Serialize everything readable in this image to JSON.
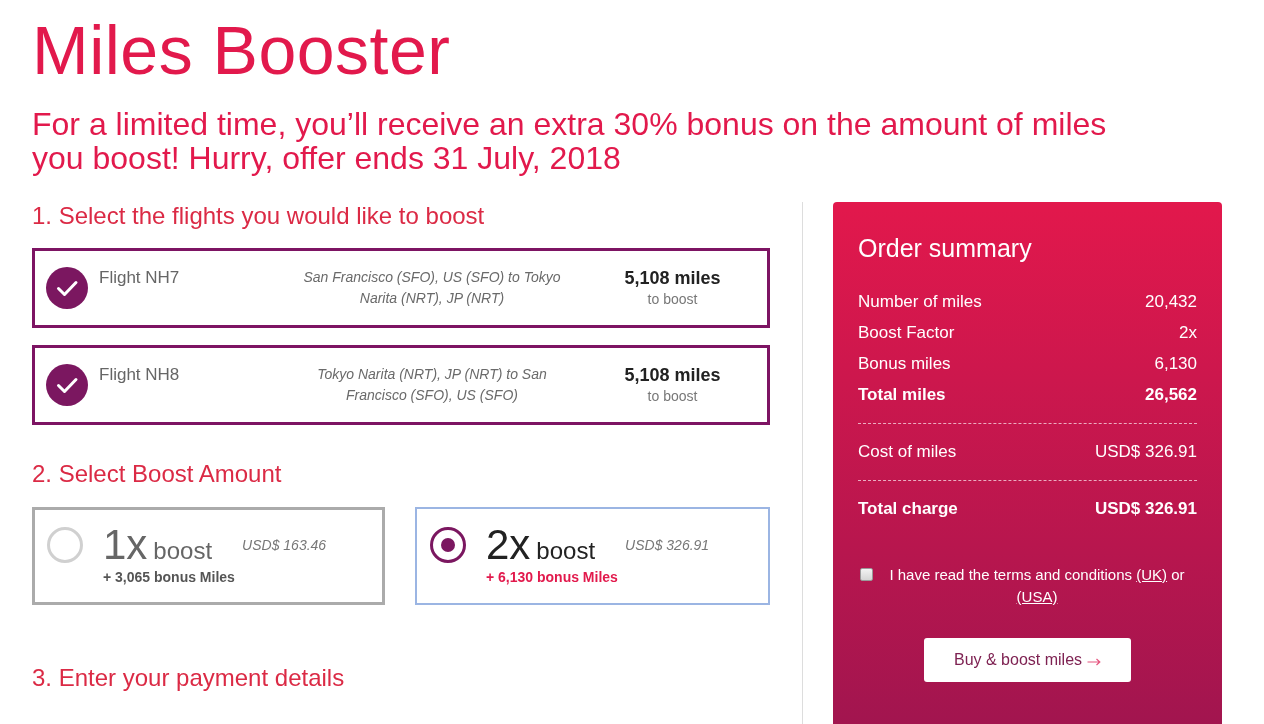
{
  "title": "Miles Booster",
  "promo": "For a limited time, you’ll receive an extra 30% bonus on the amount of miles you boost! Hurry, offer ends 31 July, 2018",
  "flights_section": {
    "heading": "1. Select the flights you would like to boost",
    "flights": [
      {
        "name": "Flight NH7",
        "route": "San Francisco (SFO), US (SFO) to Tokyo Narita (NRT), JP (NRT)",
        "miles": "5,108 miles",
        "miles_caption": "to boost",
        "checked": true
      },
      {
        "name": "Flight NH8",
        "route": "Tokyo Narita (NRT), JP (NRT) to San Francisco (SFO), US (SFO)",
        "miles": "5,108 miles",
        "miles_caption": "to boost",
        "checked": true
      }
    ]
  },
  "boost_section": {
    "heading": "2. Select Boost Amount",
    "options": [
      {
        "factor": "1x",
        "label": "boost",
        "price": "USD$ 163.46",
        "bonus": "+ 3,065 bonus Miles",
        "selected": false
      },
      {
        "factor": "2x",
        "label": "boost",
        "price": "USD$ 326.91",
        "bonus": "+ 6,130 bonus Miles",
        "selected": true
      }
    ]
  },
  "payment_section": {
    "heading": "3. Enter your payment details"
  },
  "order_summary": {
    "title": "Order summary",
    "groups": [
      {
        "rows": [
          {
            "label": "Number of miles",
            "value": "20,432",
            "kind": "item"
          },
          {
            "label": "Boost Factor",
            "value": "2x",
            "kind": "item"
          },
          {
            "label": "Bonus miles",
            "value": "6,130",
            "kind": "item"
          },
          {
            "label": "Total miles",
            "value": "26,562",
            "kind": "total"
          }
        ]
      },
      {
        "rows": [
          {
            "label": "Cost of miles",
            "value": "USD$ 326.91",
            "kind": "item"
          }
        ]
      },
      {
        "rows": [
          {
            "label": "Total charge",
            "value": "USD$ 326.91",
            "kind": "total"
          }
        ]
      }
    ],
    "terms": {
      "checked": false,
      "parts": [
        {
          "kind": "text",
          "text": "I have read the terms and conditions"
        },
        {
          "kind": "link",
          "text": "(UK)"
        },
        {
          "kind": "text",
          "text": "or"
        },
        {
          "kind": "link",
          "text": "(USA)"
        }
      ]
    },
    "buy_button": {
      "label": "Buy & boost miles"
    }
  }
}
